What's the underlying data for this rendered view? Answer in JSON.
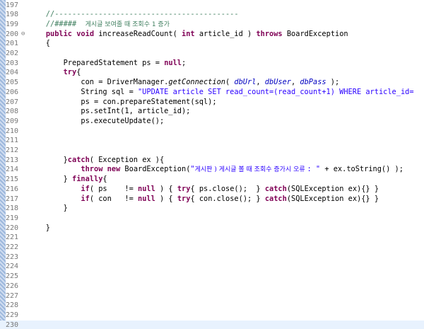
{
  "editor": {
    "lines": [
      {
        "n": "197",
        "segs": []
      },
      {
        "n": "198",
        "segs": [
          {
            "t": "    //------------------------------------------",
            "c": "cm"
          }
        ]
      },
      {
        "n": "199",
        "segs": [
          {
            "t": "    //#####  ",
            "c": "cm"
          },
          {
            "t": "게시글 보여줄 때 조회수 1 증가",
            "c": "cm ko"
          }
        ]
      },
      {
        "n": "200",
        "fold": "⊖",
        "segs": [
          {
            "t": "    ",
            "c": ""
          },
          {
            "t": "public",
            "c": "kw"
          },
          {
            "t": " ",
            "c": ""
          },
          {
            "t": "void",
            "c": "kw"
          },
          {
            "t": " increaseReadCount( ",
            "c": ""
          },
          {
            "t": "int",
            "c": "kw"
          },
          {
            "t": " article_id ) ",
            "c": ""
          },
          {
            "t": "throws",
            "c": "kw"
          },
          {
            "t": " BoardException",
            "c": ""
          }
        ]
      },
      {
        "n": "201",
        "segs": [
          {
            "t": "    {",
            "c": ""
          }
        ]
      },
      {
        "n": "202",
        "segs": []
      },
      {
        "n": "203",
        "segs": [
          {
            "t": "        PreparedStatement ps = ",
            "c": ""
          },
          {
            "t": "null",
            "c": "kw"
          },
          {
            "t": ";",
            "c": ""
          }
        ]
      },
      {
        "n": "204",
        "segs": [
          {
            "t": "        ",
            "c": ""
          },
          {
            "t": "try",
            "c": "kw"
          },
          {
            "t": "{",
            "c": ""
          }
        ]
      },
      {
        "n": "205",
        "segs": [
          {
            "t": "            con = DriverManager.",
            "c": ""
          },
          {
            "t": "getConnection",
            "c": "it"
          },
          {
            "t": "( ",
            "c": ""
          },
          {
            "t": "dbUrl",
            "c": "fi it"
          },
          {
            "t": ", ",
            "c": ""
          },
          {
            "t": "dbUser",
            "c": "fi it"
          },
          {
            "t": ", ",
            "c": ""
          },
          {
            "t": "dbPass",
            "c": "fi it"
          },
          {
            "t": " );",
            "c": ""
          }
        ]
      },
      {
        "n": "206",
        "segs": [
          {
            "t": "            String sql = ",
            "c": ""
          },
          {
            "t": "\"UPDATE article SET read_count=(read_count+1) WHERE article_id=",
            "c": "st"
          }
        ]
      },
      {
        "n": "207",
        "segs": [
          {
            "t": "            ps = con.prepareStatement(sql);",
            "c": ""
          }
        ]
      },
      {
        "n": "208",
        "segs": [
          {
            "t": "            ps.setInt(1, article_id);",
            "c": ""
          }
        ]
      },
      {
        "n": "209",
        "segs": [
          {
            "t": "            ps.executeUpdate();",
            "c": ""
          }
        ]
      },
      {
        "n": "210",
        "segs": []
      },
      {
        "n": "211",
        "segs": []
      },
      {
        "n": "212",
        "segs": []
      },
      {
        "n": "213",
        "segs": [
          {
            "t": "        }",
            "c": ""
          },
          {
            "t": "catch",
            "c": "kw"
          },
          {
            "t": "( Exception ex ){",
            "c": ""
          }
        ]
      },
      {
        "n": "214",
        "segs": [
          {
            "t": "            ",
            "c": ""
          },
          {
            "t": "throw",
            "c": "kw"
          },
          {
            "t": " ",
            "c": ""
          },
          {
            "t": "new",
            "c": "kw"
          },
          {
            "t": " BoardException(",
            "c": ""
          },
          {
            "t": "\"",
            "c": "st"
          },
          {
            "t": "게시판 ) 게시글 볼 때 조회수 증가시 오류 ",
            "c": "st ko"
          },
          {
            "t": ": \"",
            "c": "st"
          },
          {
            "t": " + ex.toString() );",
            "c": ""
          }
        ]
      },
      {
        "n": "215",
        "segs": [
          {
            "t": "        } ",
            "c": ""
          },
          {
            "t": "finally",
            "c": "kw"
          },
          {
            "t": "{",
            "c": ""
          }
        ]
      },
      {
        "n": "216",
        "segs": [
          {
            "t": "            ",
            "c": ""
          },
          {
            "t": "if",
            "c": "kw"
          },
          {
            "t": "( ps    != ",
            "c": ""
          },
          {
            "t": "null",
            "c": "kw"
          },
          {
            "t": " ) { ",
            "c": ""
          },
          {
            "t": "try",
            "c": "kw"
          },
          {
            "t": "{ ps.close();  } ",
            "c": ""
          },
          {
            "t": "catch",
            "c": "kw"
          },
          {
            "t": "(SQLException ex){} }",
            "c": ""
          }
        ]
      },
      {
        "n": "217",
        "segs": [
          {
            "t": "            ",
            "c": ""
          },
          {
            "t": "if",
            "c": "kw"
          },
          {
            "t": "( con   != ",
            "c": ""
          },
          {
            "t": "null",
            "c": "kw"
          },
          {
            "t": " ) { ",
            "c": ""
          },
          {
            "t": "try",
            "c": "kw"
          },
          {
            "t": "{ con.close(); } ",
            "c": ""
          },
          {
            "t": "catch",
            "c": "kw"
          },
          {
            "t": "(SQLException ex){} }",
            "c": ""
          }
        ]
      },
      {
        "n": "218",
        "segs": [
          {
            "t": "        }",
            "c": ""
          }
        ]
      },
      {
        "n": "219",
        "segs": []
      },
      {
        "n": "220",
        "segs": [
          {
            "t": "    }",
            "c": ""
          }
        ]
      },
      {
        "n": "221",
        "segs": []
      },
      {
        "n": "222",
        "segs": []
      },
      {
        "n": "223",
        "segs": []
      },
      {
        "n": "224",
        "segs": []
      },
      {
        "n": "225",
        "segs": []
      },
      {
        "n": "226",
        "segs": []
      },
      {
        "n": "227",
        "segs": []
      },
      {
        "n": "228",
        "segs": []
      },
      {
        "n": "229",
        "segs": []
      },
      {
        "n": "230",
        "segs": [],
        "current": true
      }
    ]
  }
}
